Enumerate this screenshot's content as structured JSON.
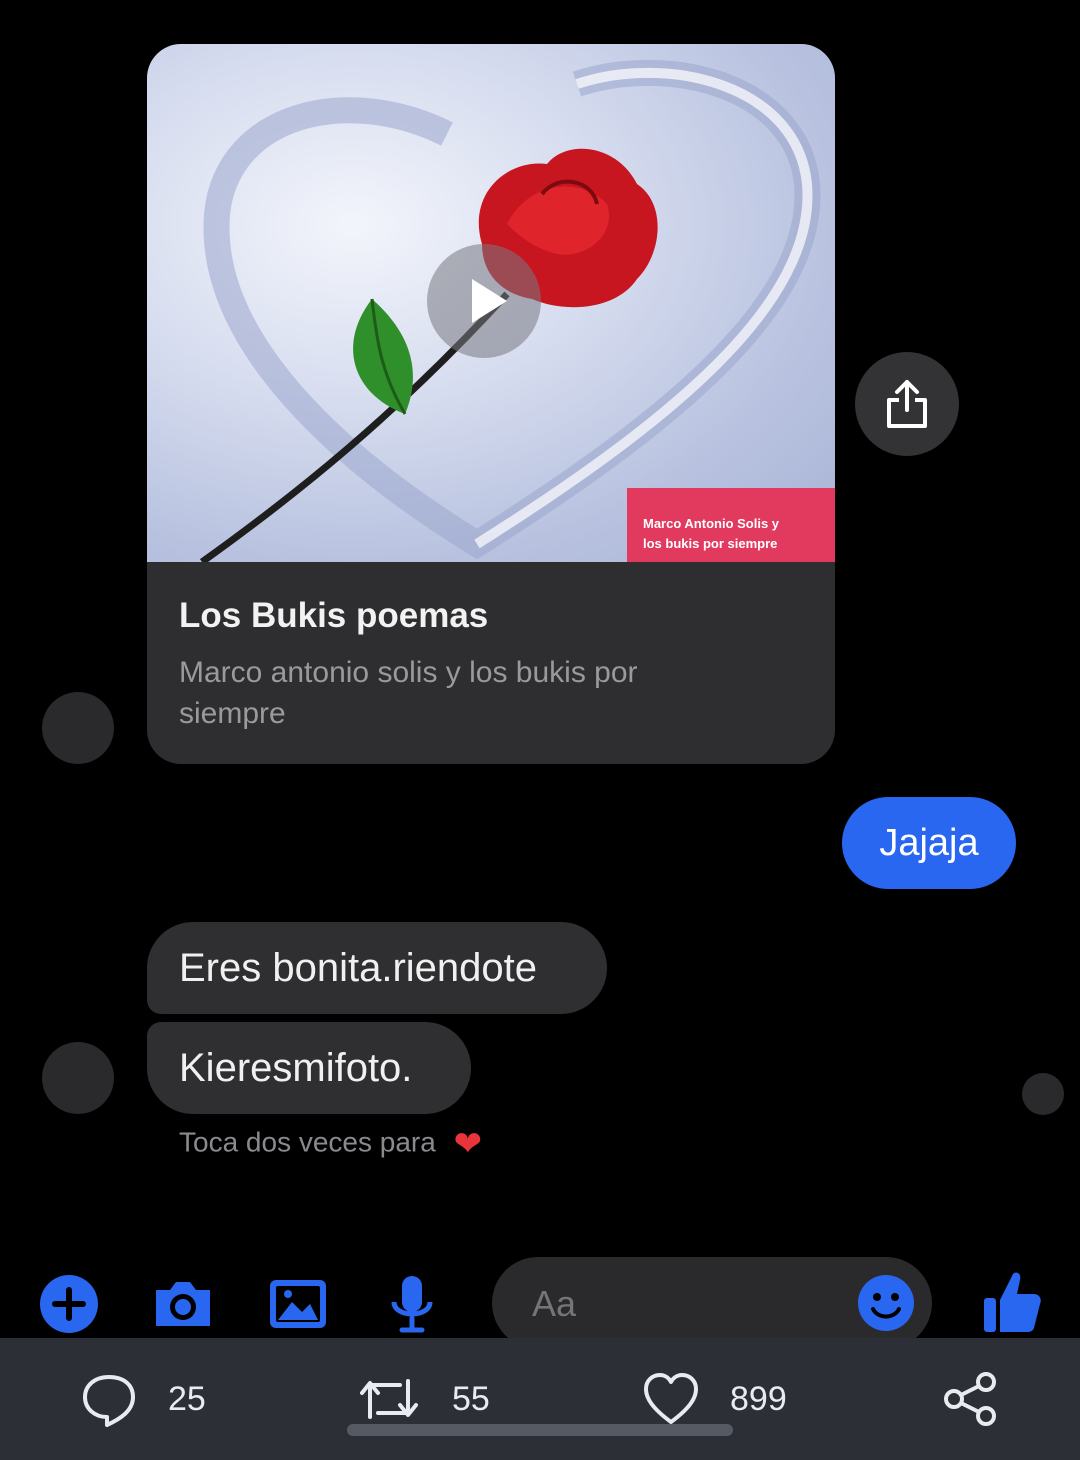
{
  "card": {
    "watermark_line1": "Marco Antonio Solis y",
    "watermark_line2": "los bukis por siempre",
    "title": "Los Bukis poemas",
    "subtitle": "Marco antonio solis y los bukis por siempre"
  },
  "messages": {
    "outgoing": "Jajaja",
    "incoming": [
      "Eres bonita.riendote",
      "Kieresmifoto."
    ],
    "hint": "Toca dos veces para",
    "hint_icon": "heart-icon"
  },
  "composer": {
    "placeholder": "Aa"
  },
  "toolbar": {
    "icons": [
      "plus-icon",
      "camera-icon",
      "gallery-icon",
      "microphone-icon",
      "emoji-icon",
      "thumbs-up-icon"
    ],
    "accent_color": "#2a67f0"
  },
  "post_actions": {
    "replies": "25",
    "retweets": "55",
    "likes": "899"
  },
  "colors": {
    "background": "#000000",
    "bubble_incoming": "#2f2f31",
    "bubble_outgoing": "#2a67f0",
    "bottom_bar": "#2c3036"
  }
}
